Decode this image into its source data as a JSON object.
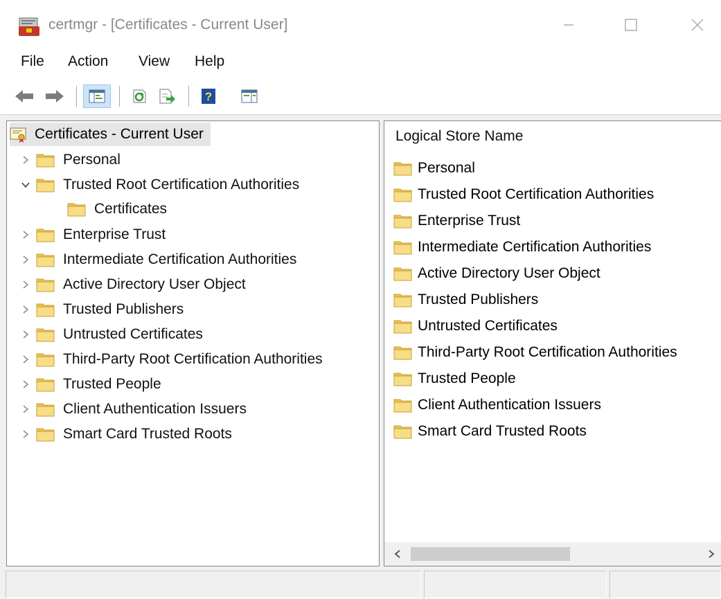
{
  "window": {
    "title": "certmgr - [Certificates - Current User]",
    "app_icon": "certificate-manager-icon",
    "controls": [
      "minimize-icon",
      "maximize-icon",
      "close-icon"
    ]
  },
  "menubar": {
    "items": [
      {
        "label": "File"
      },
      {
        "label": "Action"
      },
      {
        "label": "View"
      },
      {
        "label": "Help"
      }
    ]
  },
  "toolbar": {
    "buttons": [
      "back-arrow-icon",
      "forward-arrow-icon",
      "show-hide-console-tree-icon",
      "refresh-icon",
      "export-list-icon",
      "help-icon",
      "show-hide-action-pane-icon"
    ]
  },
  "tree": {
    "root": {
      "label": "Certificates - Current User",
      "icon": "certificate-store-icon",
      "selected": true
    },
    "items": [
      {
        "label": "Personal",
        "expanded": false
      },
      {
        "label": "Trusted Root Certification Authorities",
        "expanded": true,
        "children": [
          {
            "label": "Certificates"
          }
        ]
      },
      {
        "label": "Enterprise Trust",
        "expanded": false
      },
      {
        "label": "Intermediate Certification Authorities",
        "expanded": false
      },
      {
        "label": "Active Directory User Object",
        "expanded": false
      },
      {
        "label": "Trusted Publishers",
        "expanded": false
      },
      {
        "label": "Untrusted Certificates",
        "expanded": false
      },
      {
        "label": "Third-Party Root Certification Authorities",
        "expanded": false
      },
      {
        "label": "Trusted People",
        "expanded": false
      },
      {
        "label": "Client Authentication Issuers",
        "expanded": false
      },
      {
        "label": "Smart Card Trusted Roots",
        "expanded": false
      }
    ]
  },
  "list": {
    "column_header": "Logical Store Name",
    "rows": [
      {
        "label": "Personal"
      },
      {
        "label": "Trusted Root Certification Authorities"
      },
      {
        "label": "Enterprise Trust"
      },
      {
        "label": "Intermediate Certification Authorities"
      },
      {
        "label": "Active Directory User Object"
      },
      {
        "label": "Trusted Publishers"
      },
      {
        "label": "Untrusted Certificates"
      },
      {
        "label": "Third-Party Root Certification Authorities"
      },
      {
        "label": "Trusted People"
      },
      {
        "label": "Client Authentication Issuers"
      },
      {
        "label": "Smart Card Trusted Roots"
      }
    ]
  },
  "colors": {
    "folder": "#e8c254",
    "selection": "#e5e5e5",
    "pressed_toolbar": "#cde4f7"
  }
}
